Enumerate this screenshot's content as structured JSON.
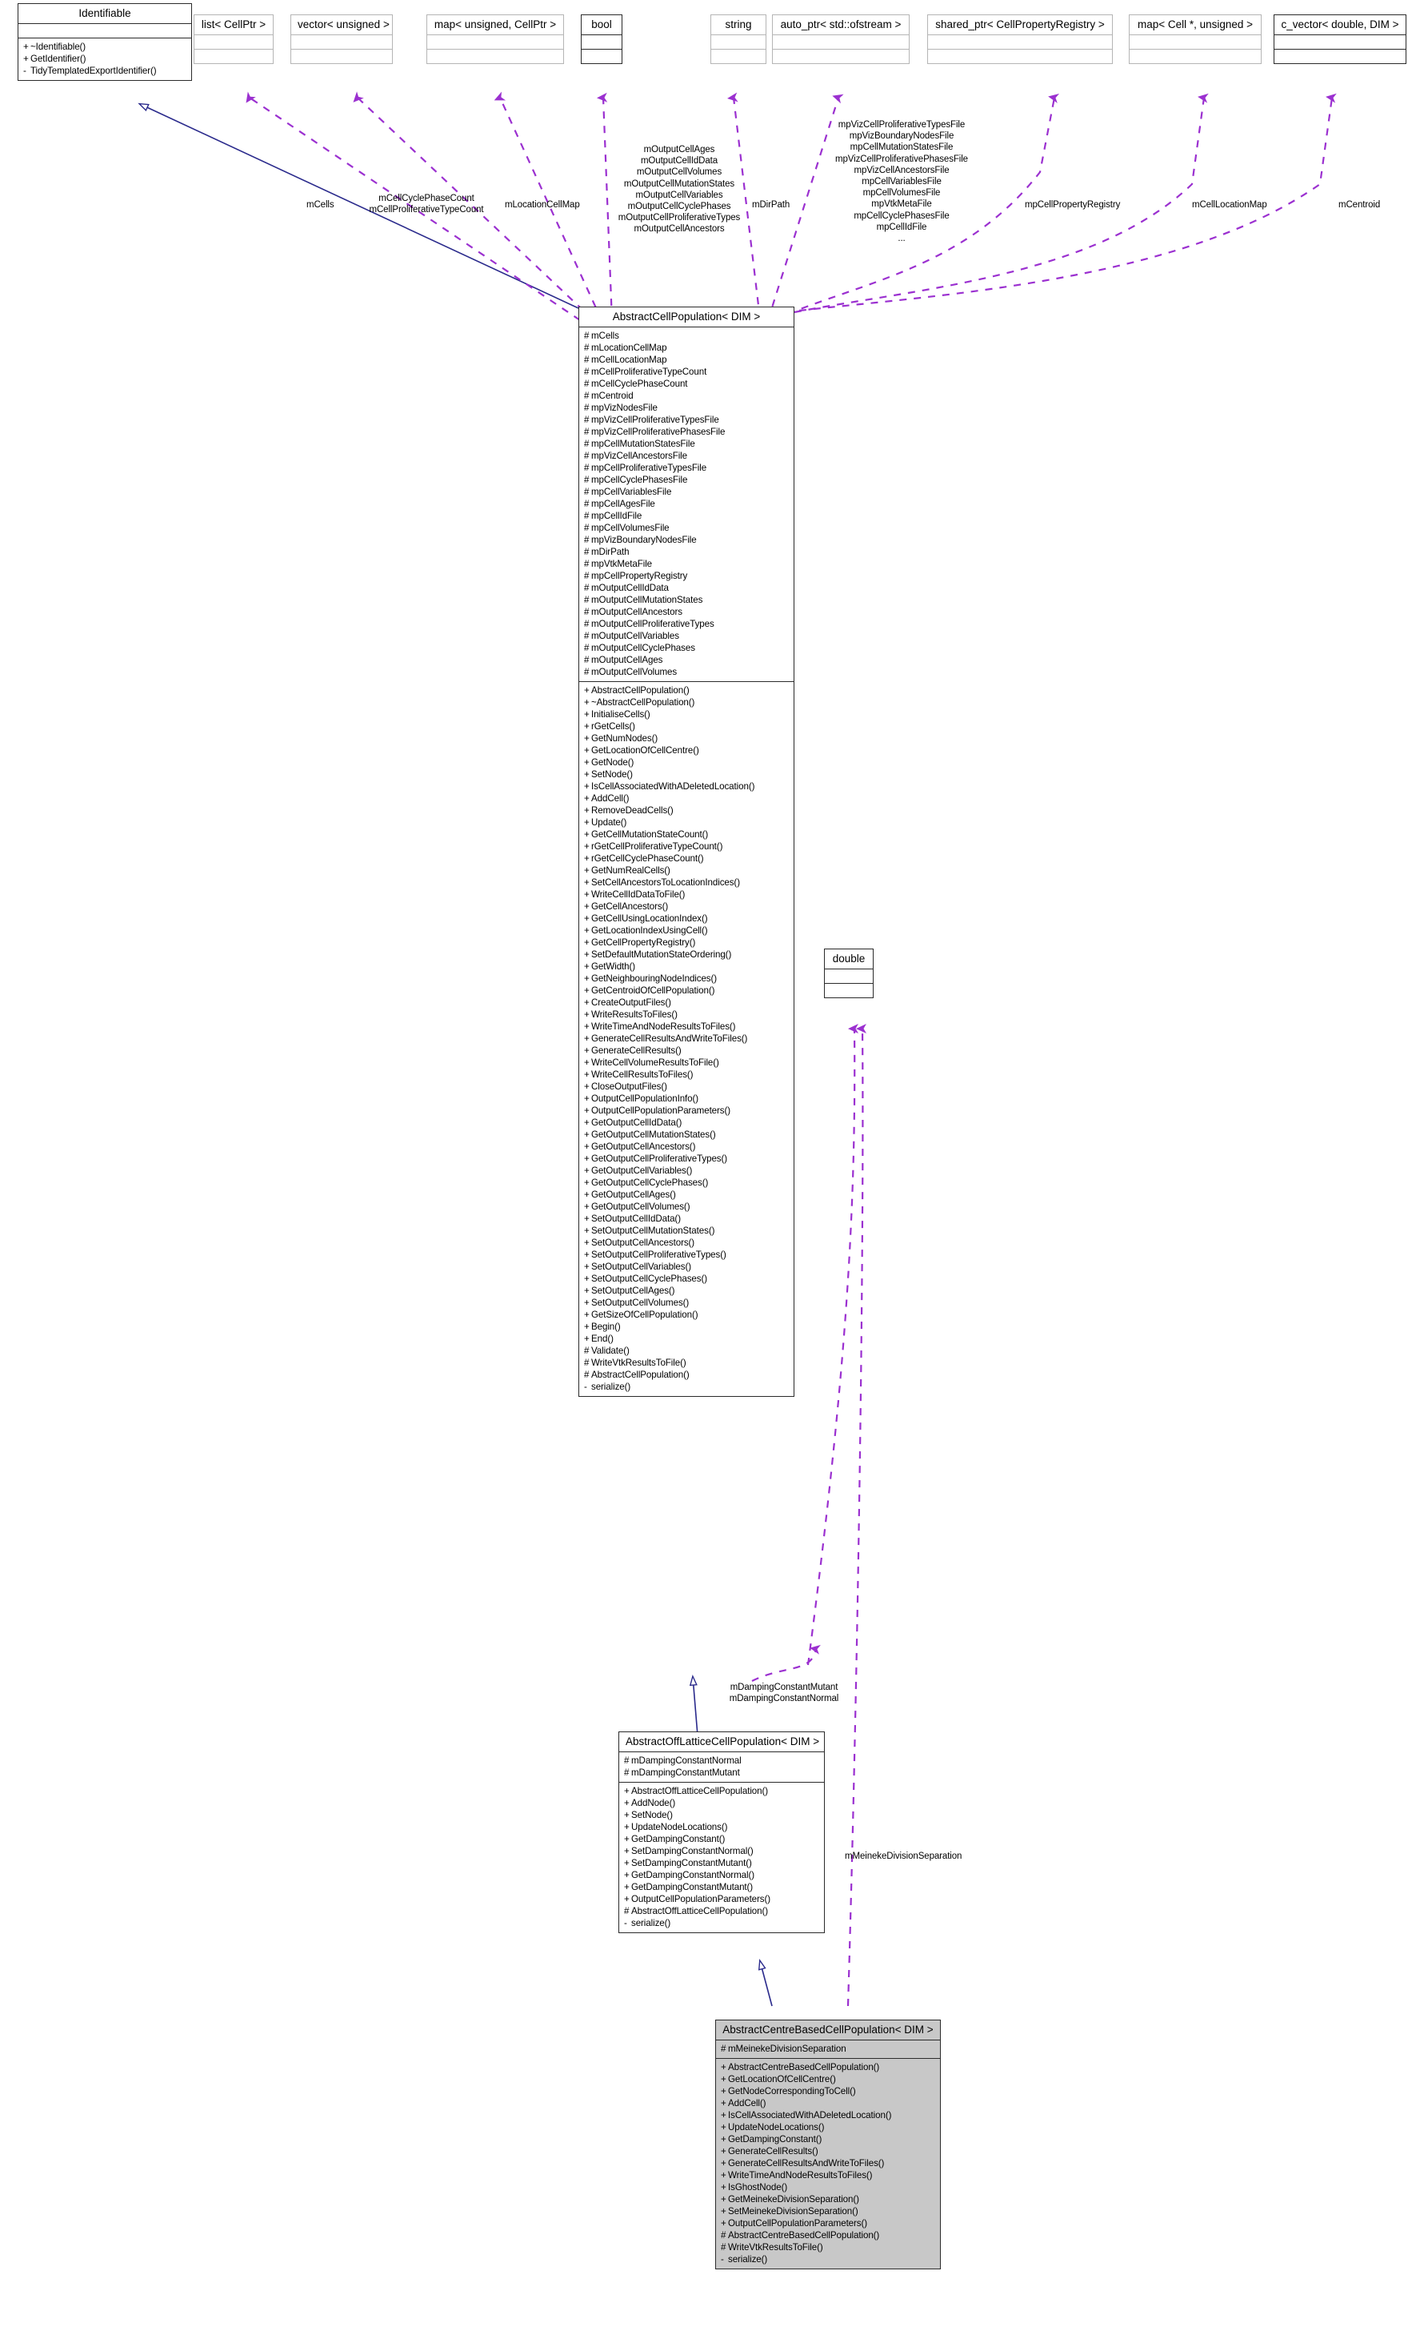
{
  "diagram": {
    "kind": "uml-class-inheritance-collaboration",
    "colors": {
      "inheritance_edge": "#2a2a8c",
      "association_edge": "#9b30d0",
      "box_border_light": "#b5b5b5",
      "box_border_strong": "#2b2b2b",
      "highlight_fill": "#c8c8c8",
      "background": "#ffffff"
    }
  },
  "nodes": {
    "identifiable": {
      "title": "Identifiable",
      "attributes": [],
      "methods": [
        {
          "vis": "+",
          "name": "~Identifiable()"
        },
        {
          "vis": "+",
          "name": "GetIdentifier()"
        },
        {
          "vis": "-",
          "name": "TidyTemplatedExportIdentifier()"
        }
      ]
    },
    "list_cellptr": {
      "title": "list< CellPtr >",
      "attributes": [],
      "methods": []
    },
    "vector_unsigned": {
      "title": "vector< unsigned >",
      "attributes": [],
      "methods": []
    },
    "map_unsigned_cellptr": {
      "title": "map< unsigned, CellPtr >",
      "attributes": [],
      "methods": []
    },
    "bool": {
      "title": "bool",
      "attributes": [],
      "methods": []
    },
    "string": {
      "title": "string",
      "attributes": [],
      "methods": []
    },
    "auto_ptr_ofstream": {
      "title": "auto_ptr< std::ofstream >",
      "attributes": [],
      "methods": []
    },
    "shared_ptr_registry": {
      "title": "shared_ptr< CellPropertyRegistry >",
      "attributes": [],
      "methods": []
    },
    "map_cell_unsigned": {
      "title": "map< Cell *, unsigned >",
      "attributes": [],
      "methods": []
    },
    "c_vector_double_dim": {
      "title": "c_vector< double, DIM >",
      "attributes": [],
      "methods": []
    },
    "double": {
      "title": "double",
      "attributes": [],
      "methods": []
    },
    "abstract_cell_population": {
      "title": "AbstractCellPopulation< DIM >",
      "attributes": [
        {
          "vis": "#",
          "name": "mCells"
        },
        {
          "vis": "#",
          "name": "mLocationCellMap"
        },
        {
          "vis": "#",
          "name": "mCellLocationMap"
        },
        {
          "vis": "#",
          "name": "mCellProliferativeTypeCount"
        },
        {
          "vis": "#",
          "name": "mCellCyclePhaseCount"
        },
        {
          "vis": "#",
          "name": "mCentroid"
        },
        {
          "vis": "#",
          "name": "mpVizNodesFile"
        },
        {
          "vis": "#",
          "name": "mpVizCellProliferativeTypesFile"
        },
        {
          "vis": "#",
          "name": "mpVizCellProliferativePhasesFile"
        },
        {
          "vis": "#",
          "name": "mpCellMutationStatesFile"
        },
        {
          "vis": "#",
          "name": "mpVizCellAncestorsFile"
        },
        {
          "vis": "#",
          "name": "mpCellProliferativeTypesFile"
        },
        {
          "vis": "#",
          "name": "mpCellCyclePhasesFile"
        },
        {
          "vis": "#",
          "name": "mpCellVariablesFile"
        },
        {
          "vis": "#",
          "name": "mpCellAgesFile"
        },
        {
          "vis": "#",
          "name": "mpCellIdFile"
        },
        {
          "vis": "#",
          "name": "mpCellVolumesFile"
        },
        {
          "vis": "#",
          "name": "mpVizBoundaryNodesFile"
        },
        {
          "vis": "#",
          "name": "mDirPath"
        },
        {
          "vis": "#",
          "name": "mpVtkMetaFile"
        },
        {
          "vis": "#",
          "name": "mpCellPropertyRegistry"
        },
        {
          "vis": "#",
          "name": "mOutputCellIdData"
        },
        {
          "vis": "#",
          "name": "mOutputCellMutationStates"
        },
        {
          "vis": "#",
          "name": "mOutputCellAncestors"
        },
        {
          "vis": "#",
          "name": "mOutputCellProliferativeTypes"
        },
        {
          "vis": "#",
          "name": "mOutputCellVariables"
        },
        {
          "vis": "#",
          "name": "mOutputCellCyclePhases"
        },
        {
          "vis": "#",
          "name": "mOutputCellAges"
        },
        {
          "vis": "#",
          "name": "mOutputCellVolumes"
        }
      ],
      "methods": [
        {
          "vis": "+",
          "name": "AbstractCellPopulation()"
        },
        {
          "vis": "+",
          "name": "~AbstractCellPopulation()"
        },
        {
          "vis": "+",
          "name": "InitialiseCells()"
        },
        {
          "vis": "+",
          "name": "rGetCells()"
        },
        {
          "vis": "+",
          "name": "GetNumNodes()"
        },
        {
          "vis": "+",
          "name": "GetLocationOfCellCentre()"
        },
        {
          "vis": "+",
          "name": "GetNode()"
        },
        {
          "vis": "+",
          "name": "SetNode()"
        },
        {
          "vis": "+",
          "name": "IsCellAssociatedWithADeletedLocation()"
        },
        {
          "vis": "+",
          "name": "AddCell()"
        },
        {
          "vis": "+",
          "name": "RemoveDeadCells()"
        },
        {
          "vis": "+",
          "name": "Update()"
        },
        {
          "vis": "+",
          "name": "GetCellMutationStateCount()"
        },
        {
          "vis": "+",
          "name": "rGetCellProliferativeTypeCount()"
        },
        {
          "vis": "+",
          "name": "rGetCellCyclePhaseCount()"
        },
        {
          "vis": "+",
          "name": "GetNumRealCells()"
        },
        {
          "vis": "+",
          "name": "SetCellAncestorsToLocationIndices()"
        },
        {
          "vis": "+",
          "name": "WriteCellIdDataToFile()"
        },
        {
          "vis": "+",
          "name": "GetCellAncestors()"
        },
        {
          "vis": "+",
          "name": "GetCellUsingLocationIndex()"
        },
        {
          "vis": "+",
          "name": "GetLocationIndexUsingCell()"
        },
        {
          "vis": "+",
          "name": "GetCellPropertyRegistry()"
        },
        {
          "vis": "+",
          "name": "SetDefaultMutationStateOrdering()"
        },
        {
          "vis": "+",
          "name": "GetWidth()"
        },
        {
          "vis": "+",
          "name": "GetNeighbouringNodeIndices()"
        },
        {
          "vis": "+",
          "name": "GetCentroidOfCellPopulation()"
        },
        {
          "vis": "+",
          "name": "CreateOutputFiles()"
        },
        {
          "vis": "+",
          "name": "WriteResultsToFiles()"
        },
        {
          "vis": "+",
          "name": "WriteTimeAndNodeResultsToFiles()"
        },
        {
          "vis": "+",
          "name": "GenerateCellResultsAndWriteToFiles()"
        },
        {
          "vis": "+",
          "name": "GenerateCellResults()"
        },
        {
          "vis": "+",
          "name": "WriteCellVolumeResultsToFile()"
        },
        {
          "vis": "+",
          "name": "WriteCellResultsToFiles()"
        },
        {
          "vis": "+",
          "name": "CloseOutputFiles()"
        },
        {
          "vis": "+",
          "name": "OutputCellPopulationInfo()"
        },
        {
          "vis": "+",
          "name": "OutputCellPopulationParameters()"
        },
        {
          "vis": "+",
          "name": "GetOutputCellIdData()"
        },
        {
          "vis": "+",
          "name": "GetOutputCellMutationStates()"
        },
        {
          "vis": "+",
          "name": "GetOutputCellAncestors()"
        },
        {
          "vis": "+",
          "name": "GetOutputCellProliferativeTypes()"
        },
        {
          "vis": "+",
          "name": "GetOutputCellVariables()"
        },
        {
          "vis": "+",
          "name": "GetOutputCellCyclePhases()"
        },
        {
          "vis": "+",
          "name": "GetOutputCellAges()"
        },
        {
          "vis": "+",
          "name": "GetOutputCellVolumes()"
        },
        {
          "vis": "+",
          "name": "SetOutputCellIdData()"
        },
        {
          "vis": "+",
          "name": "SetOutputCellMutationStates()"
        },
        {
          "vis": "+",
          "name": "SetOutputCellAncestors()"
        },
        {
          "vis": "+",
          "name": "SetOutputCellProliferativeTypes()"
        },
        {
          "vis": "+",
          "name": "SetOutputCellVariables()"
        },
        {
          "vis": "+",
          "name": "SetOutputCellCyclePhases()"
        },
        {
          "vis": "+",
          "name": "SetOutputCellAges()"
        },
        {
          "vis": "+",
          "name": "SetOutputCellVolumes()"
        },
        {
          "vis": "+",
          "name": "GetSizeOfCellPopulation()"
        },
        {
          "vis": "+",
          "name": "Begin()"
        },
        {
          "vis": "+",
          "name": "End()"
        },
        {
          "vis": "#",
          "name": "Validate()"
        },
        {
          "vis": "#",
          "name": "WriteVtkResultsToFile()"
        },
        {
          "vis": "#",
          "name": "AbstractCellPopulation()"
        },
        {
          "vis": "-",
          "name": "serialize()"
        }
      ]
    },
    "abstract_off_lattice_cell_population": {
      "title": "AbstractOffLatticeCellPopulation< DIM >",
      "attributes": [
        {
          "vis": "#",
          "name": "mDampingConstantNormal"
        },
        {
          "vis": "#",
          "name": "mDampingConstantMutant"
        }
      ],
      "methods": [
        {
          "vis": "+",
          "name": "AbstractOffLatticeCellPopulation()"
        },
        {
          "vis": "+",
          "name": "AddNode()"
        },
        {
          "vis": "+",
          "name": "SetNode()"
        },
        {
          "vis": "+",
          "name": "UpdateNodeLocations()"
        },
        {
          "vis": "+",
          "name": "GetDampingConstant()"
        },
        {
          "vis": "+",
          "name": "SetDampingConstantNormal()"
        },
        {
          "vis": "+",
          "name": "SetDampingConstantMutant()"
        },
        {
          "vis": "+",
          "name": "GetDampingConstantNormal()"
        },
        {
          "vis": "+",
          "name": "GetDampingConstantMutant()"
        },
        {
          "vis": "+",
          "name": "OutputCellPopulationParameters()"
        },
        {
          "vis": "#",
          "name": "AbstractOffLatticeCellPopulation()"
        },
        {
          "vis": "-",
          "name": "serialize()"
        }
      ]
    },
    "abstract_centre_based_cell_population": {
      "title": "AbstractCentreBasedCellPopulation< DIM >",
      "attributes": [
        {
          "vis": "#",
          "name": "mMeinekeDivisionSeparation"
        }
      ],
      "methods": [
        {
          "vis": "+",
          "name": "AbstractCentreBasedCellPopulation()"
        },
        {
          "vis": "+",
          "name": "GetLocationOfCellCentre()"
        },
        {
          "vis": "+",
          "name": "GetNodeCorrespondingToCell()"
        },
        {
          "vis": "+",
          "name": "AddCell()"
        },
        {
          "vis": "+",
          "name": "IsCellAssociatedWithADeletedLocation()"
        },
        {
          "vis": "+",
          "name": "UpdateNodeLocations()"
        },
        {
          "vis": "+",
          "name": "GetDampingConstant()"
        },
        {
          "vis": "+",
          "name": "GenerateCellResults()"
        },
        {
          "vis": "+",
          "name": "GenerateCellResultsAndWriteToFiles()"
        },
        {
          "vis": "+",
          "name": "WriteTimeAndNodeResultsToFiles()"
        },
        {
          "vis": "+",
          "name": "IsGhostNode()"
        },
        {
          "vis": "+",
          "name": "GetMeinekeDivisionSeparation()"
        },
        {
          "vis": "+",
          "name": "SetMeinekeDivisionSeparation()"
        },
        {
          "vis": "+",
          "name": "OutputCellPopulationParameters()"
        },
        {
          "vis": "#",
          "name": "AbstractCentreBasedCellPopulation()"
        },
        {
          "vis": "#",
          "name": "WriteVtkResultsToFile()"
        },
        {
          "vis": "-",
          "name": "serialize()"
        }
      ]
    }
  },
  "edge_labels": {
    "m_cells": "mCells",
    "cell_cycle_phase_count": "mCellCyclePhaseCount\nmCellProliferativeTypeCount",
    "m_location_cell_map": "mLocationCellMap",
    "output_cell_group": "mOutputCellAges\nmOutputCellIdData\nmOutputCellVolumes\nmOutputCellMutationStates\nmOutputCellVariables\nmOutputCellCyclePhases\nmOutputCellProliferativeTypes\nmOutputCellAncestors",
    "m_dir_path": "mDirPath",
    "file_group": "mpVizCellProliferativeTypesFile\nmpVizBoundaryNodesFile\nmpCellMutationStatesFile\nmpVizCellProliferativePhasesFile\nmpVizCellAncestorsFile\nmpCellVariablesFile\nmpCellVolumesFile\nmpVtkMetaFile\nmpCellCyclePhasesFile\nmpCellIdFile\n...",
    "mp_cell_property_registry": "mpCellPropertyRegistry",
    "m_cell_location_map": "mCellLocationMap",
    "m_centroid": "mCentroid",
    "damping_constants": "mDampingConstantMutant\nmDampingConstantNormal",
    "m_meineke_division_separation": "mMeinekeDivisionSeparation"
  }
}
